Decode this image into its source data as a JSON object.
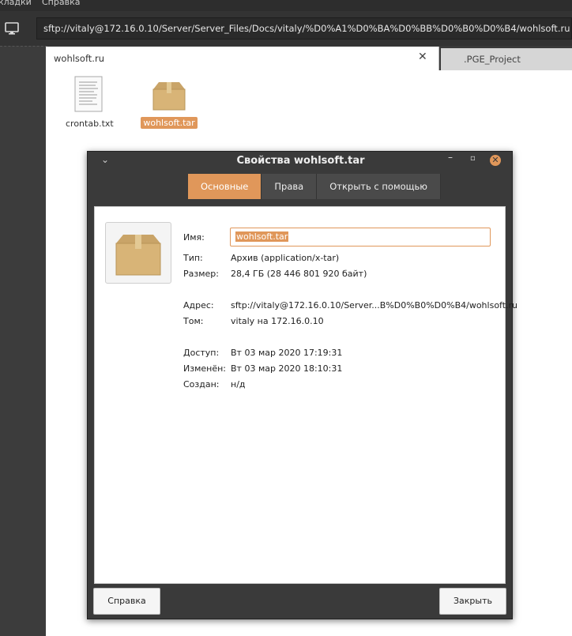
{
  "menubar": {
    "items": [
      "кладки",
      "Справка"
    ]
  },
  "location": {
    "path": "sftp://vitaly@172.16.0.10/Server/Server_Files/Docs/vitaly/%D0%A1%D0%BA%D0%BB%D0%B0%D0%B4/wohlsoft.ru",
    "icon": "computer-icon"
  },
  "tabs": [
    {
      "label": "wohlsoft.ru",
      "active": true
    },
    {
      "label": ".PGE_Project",
      "active": false
    }
  ],
  "files": [
    {
      "name": "crontab.txt",
      "icon": "text-file-icon"
    },
    {
      "name": "wohlsoft.tar",
      "icon": "archive-icon",
      "selected": true
    }
  ],
  "dialog": {
    "title": "Свойства wohlsoft.tar",
    "tabs": [
      "Основные",
      "Права",
      "Открыть с помощью"
    ],
    "fields": {
      "name_label": "Имя:",
      "name_value": "wohlsoft.tar",
      "type_label": "Тип:",
      "type_value": "Архив (application/x-tar)",
      "size_label": "Размер:",
      "size_value": "28,4 ГБ (28 446 801 920 байт)",
      "address_label": "Адрес:",
      "address_value": "sftp://vitaly@172.16.0.10/Server...B%D0%B0%D0%B4/wohlsoft.ru",
      "volume_label": "Том:",
      "volume_value": "vitaly на 172.16.0.10",
      "access_label": "Доступ:",
      "access_value": "Вт 03 мар 2020 17:19:31",
      "modified_label": "Изменён:",
      "modified_value": "Вт 03 мар 2020 18:10:31",
      "created_label": "Создан:",
      "created_value": "н/д"
    },
    "help_button": "Справка",
    "close_button": "Закрыть"
  },
  "colors": {
    "accent": "#e0975a",
    "dark": "#3a3a3a"
  }
}
